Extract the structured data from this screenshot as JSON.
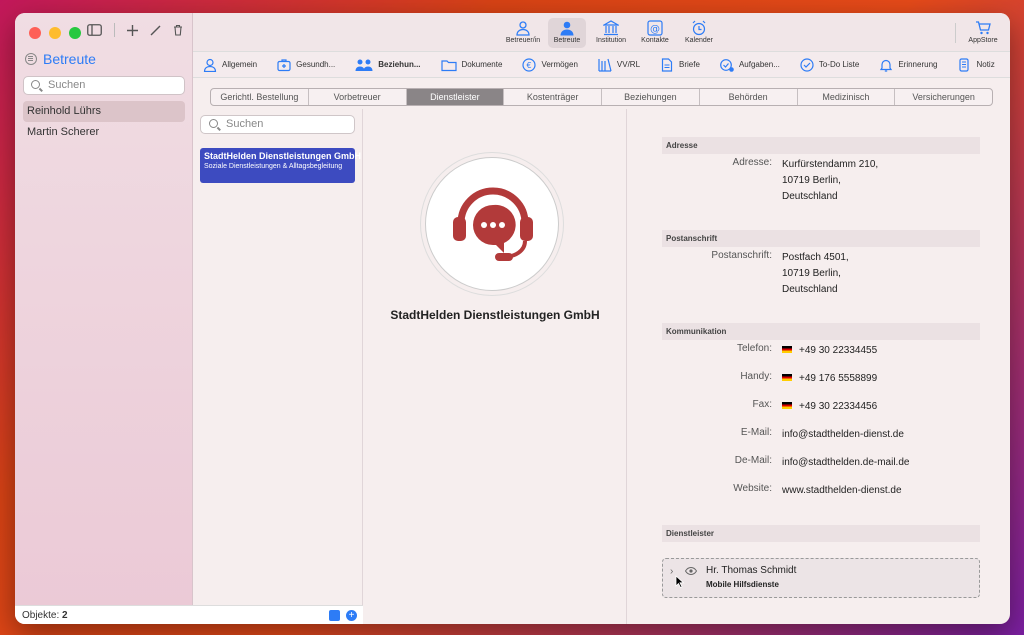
{
  "sidebar": {
    "title": "Betreute",
    "search_placeholder": "Suchen",
    "items": [
      {
        "label": "Reinhold Lührs",
        "selected": true
      },
      {
        "label": "Martin Scherer",
        "selected": false
      }
    ],
    "footer_label": "Objekte:",
    "footer_count": "2"
  },
  "toolbar": {
    "buttons": [
      {
        "label": "Betreuer/in",
        "icon": "person-badge-icon"
      },
      {
        "label": "Betreute",
        "icon": "person-icon",
        "active": true
      },
      {
        "label": "Institution",
        "icon": "building-columns-icon"
      },
      {
        "label": "Kontakte",
        "icon": "at-contact-icon"
      },
      {
        "label": "Kalender",
        "icon": "alarm-clock-icon"
      }
    ],
    "appstore_label": "AppStore"
  },
  "tabs": [
    {
      "label": "Allgemein",
      "icon": "person-icon"
    },
    {
      "label": "Gesundh...",
      "icon": "medkit-icon"
    },
    {
      "label": "Beziehun...",
      "icon": "people-icon",
      "bold": true
    },
    {
      "label": "Dokumente",
      "icon": "folder-icon"
    },
    {
      "label": "Vermögen",
      "icon": "euro-icon"
    },
    {
      "label": "VV/RL",
      "icon": "books-icon"
    },
    {
      "label": "Briefe",
      "icon": "document-icon"
    },
    {
      "label": "Aufgaben...",
      "icon": "tasks-icon"
    },
    {
      "label": "To-Do Liste",
      "icon": "checkmark-circle-icon"
    },
    {
      "label": "Erinnerung",
      "icon": "bell-icon"
    },
    {
      "label": "Notiz",
      "icon": "note-icon"
    }
  ],
  "segments": [
    {
      "label": "Gerichtl. Bestellung"
    },
    {
      "label": "Vorbetreuer"
    },
    {
      "label": "Dienstleister",
      "active": true
    },
    {
      "label": "Kostenträger"
    },
    {
      "label": "Beziehungen"
    },
    {
      "label": "Behörden"
    },
    {
      "label": "Medizinisch"
    },
    {
      "label": "Versicherungen"
    }
  ],
  "list": {
    "search_placeholder": "Suchen",
    "card_title": "StadtHelden Dienstleistungen GmbH",
    "card_subtitle": "Soziale Dienstleistungen & Alltagsbegleitung"
  },
  "company": {
    "name": "StadtHelden Dienstleistungen GmbH",
    "logo_color": "#b23a3a"
  },
  "details": {
    "adresse_head": "Adresse",
    "adresse_label": "Adresse:",
    "adresse_lines": [
      "Kurfürstendamm 210,",
      "10719 Berlin,",
      "Deutschland"
    ],
    "post_head": "Postanschrift",
    "post_label": "Postanschrift:",
    "post_lines": [
      "Postfach 4501,",
      "10719 Berlin,",
      "Deutschland"
    ],
    "komm_head": "Kommunikation",
    "telefon_label": "Telefon:",
    "telefon": "+49 30 22334455",
    "handy_label": "Handy:",
    "handy": "+49 176 5558899",
    "fax_label": "Fax:",
    "fax": "+49 30 22334456",
    "email_label": "E-Mail:",
    "email": "info@stadthelden-dienst.de",
    "demail_label": "De-Mail:",
    "demail": "info@stadthelden.de-mail.de",
    "website_label": "Website:",
    "website": "www.stadthelden-dienst.de",
    "dl_head": "Dienstleister",
    "dl_name": "Hr. Thomas Schmidt",
    "dl_role": "Mobile Hilfsdienste"
  },
  "colors": {
    "accent": "#2d7cf6",
    "card": "#3d4bc0"
  }
}
